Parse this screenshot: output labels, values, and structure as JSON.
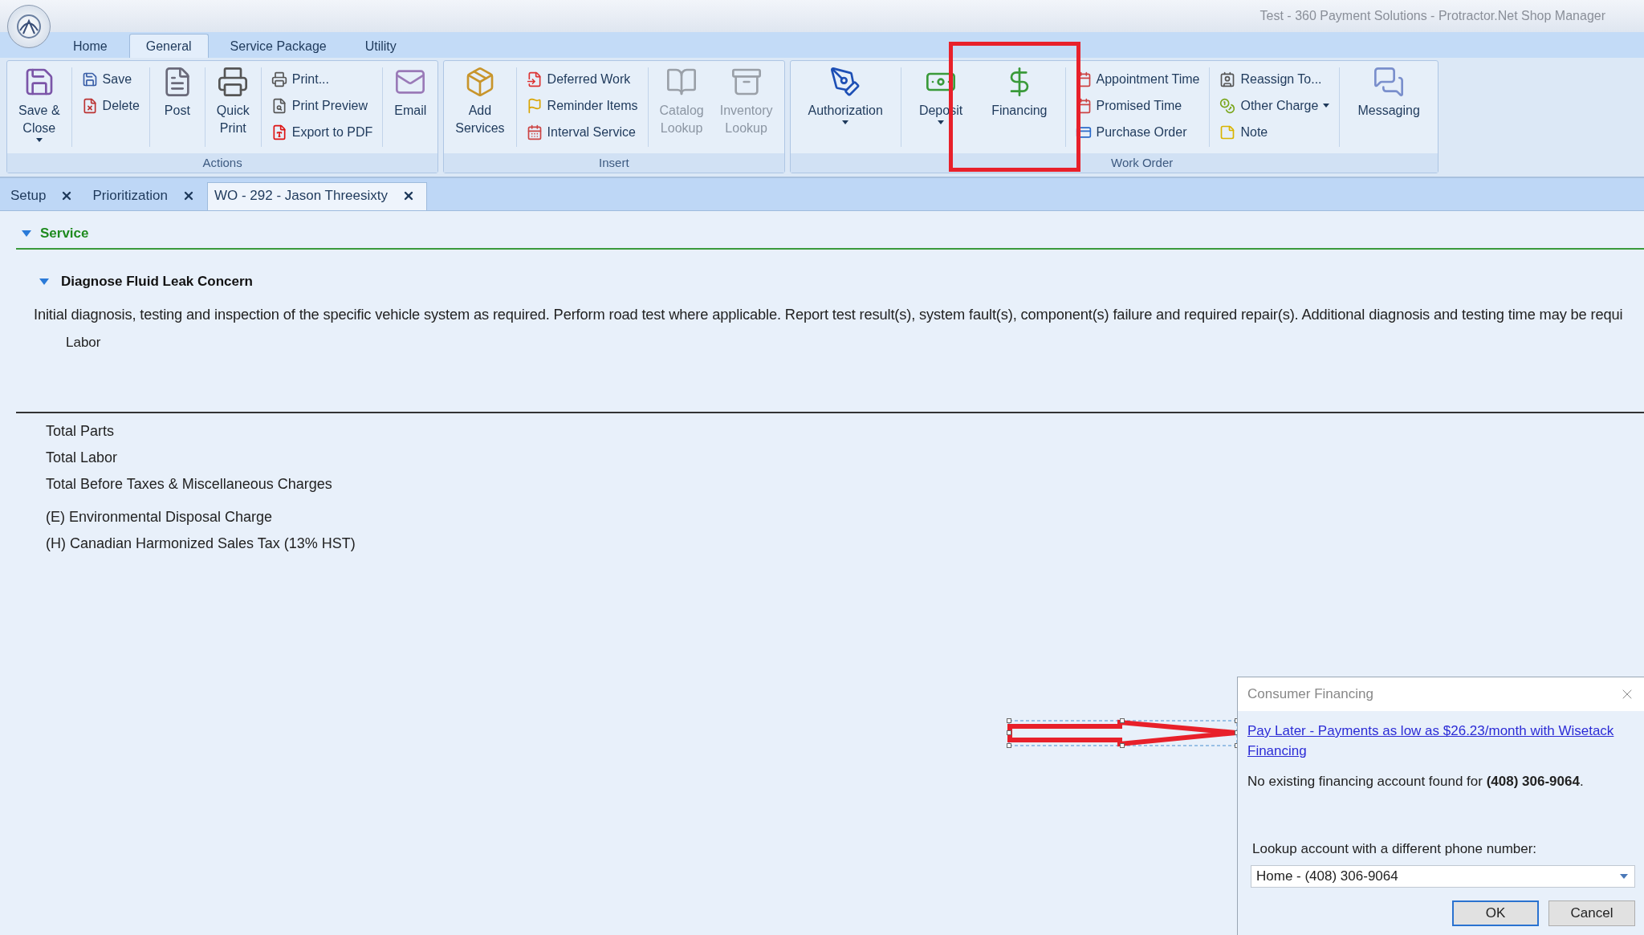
{
  "window": {
    "title": "Test - 360 Payment Solutions - Protractor.Net Shop Manager"
  },
  "ribbon_tabs": [
    {
      "label": "Home",
      "selected": false
    },
    {
      "label": "General",
      "selected": true
    },
    {
      "label": "Service Package",
      "selected": false
    },
    {
      "label": "Utility",
      "selected": false
    }
  ],
  "ribbon_groups": [
    {
      "label": "Actions",
      "columns": [
        {
          "kind": "large",
          "items": [
            {
              "lines": [
                "Save &",
                "Close"
              ],
              "dropdown": true,
              "disabled": false
            }
          ]
        },
        {
          "kind": "small",
          "items": [
            {
              "lines": [
                "Save"
              ],
              "dropdown": false,
              "disabled": false
            },
            {
              "lines": [
                "Delete"
              ],
              "dropdown": false,
              "disabled": false
            }
          ]
        },
        {
          "kind": "large",
          "items": [
            {
              "lines": [
                "Post"
              ],
              "dropdown": false,
              "disabled": false
            }
          ]
        },
        {
          "kind": "large",
          "items": [
            {
              "lines": [
                "Quick",
                "Print"
              ],
              "dropdown": false,
              "disabled": false
            }
          ]
        },
        {
          "kind": "small",
          "items": [
            {
              "lines": [
                "Print..."
              ],
              "dropdown": false,
              "disabled": false
            },
            {
              "lines": [
                "Print Preview"
              ],
              "dropdown": false,
              "disabled": false
            },
            {
              "lines": [
                "Export to PDF"
              ],
              "dropdown": false,
              "disabled": false
            }
          ]
        },
        {
          "kind": "large",
          "items": [
            {
              "lines": [
                "Email"
              ],
              "dropdown": false,
              "disabled": false
            }
          ]
        }
      ]
    },
    {
      "label": "Insert",
      "columns": [
        {
          "kind": "large",
          "items": [
            {
              "lines": [
                "Add",
                "Services"
              ],
              "dropdown": false,
              "disabled": false
            }
          ]
        },
        {
          "kind": "small",
          "items": [
            {
              "lines": [
                "Deferred Work"
              ],
              "dropdown": false,
              "disabled": false
            },
            {
              "lines": [
                "Reminder Items"
              ],
              "dropdown": false,
              "disabled": false
            },
            {
              "lines": [
                "Interval Service"
              ],
              "dropdown": false,
              "disabled": false
            }
          ]
        },
        {
          "kind": "large",
          "items": [
            {
              "lines": [
                "Catalog",
                "Lookup"
              ],
              "dropdown": false,
              "disabled": true
            }
          ]
        },
        {
          "kind": "large",
          "items": [
            {
              "lines": [
                "Inventory",
                "Lookup"
              ],
              "dropdown": false,
              "disabled": true
            }
          ]
        }
      ]
    },
    {
      "label": "Work Order",
      "columns": [
        {
          "kind": "large",
          "items": [
            {
              "lines": [
                "Authorization"
              ],
              "dropdown": true,
              "disabled": false
            }
          ]
        },
        {
          "kind": "large",
          "items": [
            {
              "lines": [
                "Deposit"
              ],
              "dropdown": true,
              "disabled": false
            }
          ]
        },
        {
          "kind": "large",
          "items": [
            {
              "lines": [
                "Financing"
              ],
              "dropdown": false,
              "disabled": false
            }
          ]
        },
        {
          "kind": "small",
          "items": [
            {
              "lines": [
                "Appointment Time"
              ],
              "dropdown": false,
              "disabled": false
            },
            {
              "lines": [
                "Promised Time"
              ],
              "dropdown": false,
              "disabled": false
            },
            {
              "lines": [
                "Purchase Order"
              ],
              "dropdown": false,
              "disabled": false
            }
          ]
        },
        {
          "kind": "small",
          "items": [
            {
              "lines": [
                "Reassign To..."
              ],
              "dropdown": false,
              "disabled": false
            },
            {
              "lines": [
                "Other Charge"
              ],
              "dropdown": true,
              "disabled": false
            },
            {
              "lines": [
                "Note"
              ],
              "dropdown": false,
              "disabled": false
            }
          ]
        },
        {
          "kind": "large",
          "items": [
            {
              "lines": [
                "Messaging"
              ],
              "dropdown": false,
              "disabled": false
            }
          ]
        }
      ]
    }
  ],
  "document_tabs": [
    {
      "label": "Setup",
      "selected": false
    },
    {
      "label": "Prioritization",
      "selected": false
    },
    {
      "label": "WO - 292 - Jason Threesixty",
      "selected": true
    }
  ],
  "section": {
    "title": "Service",
    "expanded": true
  },
  "service": {
    "title": "Diagnose Fluid Leak Concern",
    "expanded": true,
    "description": "Initial diagnosis, testing and inspection of the specific vehicle system as required.  Perform road test where applicable.  Report test result(s), system fault(s), component(s) failure and required repair(s).  Additional diagnosis and testing time may be requi",
    "lines": [
      "Labor"
    ]
  },
  "totals": [
    [
      "Total Parts",
      "Total Labor",
      "Total Before Taxes & Miscellaneous Charges"
    ],
    [
      "(E) Environmental Disposal Charge",
      "(H) Canadian Harmonized Sales Tax (13% HST)"
    ]
  ],
  "dialog": {
    "title": "Consumer Financing",
    "link": "Pay Later - Payments as low as $26.23/month with Wisetack Financing",
    "message": "No existing financing account found for **(408) 306-9064**.",
    "lookup_label": "Lookup account with a different phone number:",
    "phone_select": {
      "value": "Home - (408) 306-9064"
    },
    "buttons": [
      {
        "label": "OK",
        "kind": "default"
      },
      {
        "label": "Cancel",
        "kind": "normal"
      }
    ]
  }
}
